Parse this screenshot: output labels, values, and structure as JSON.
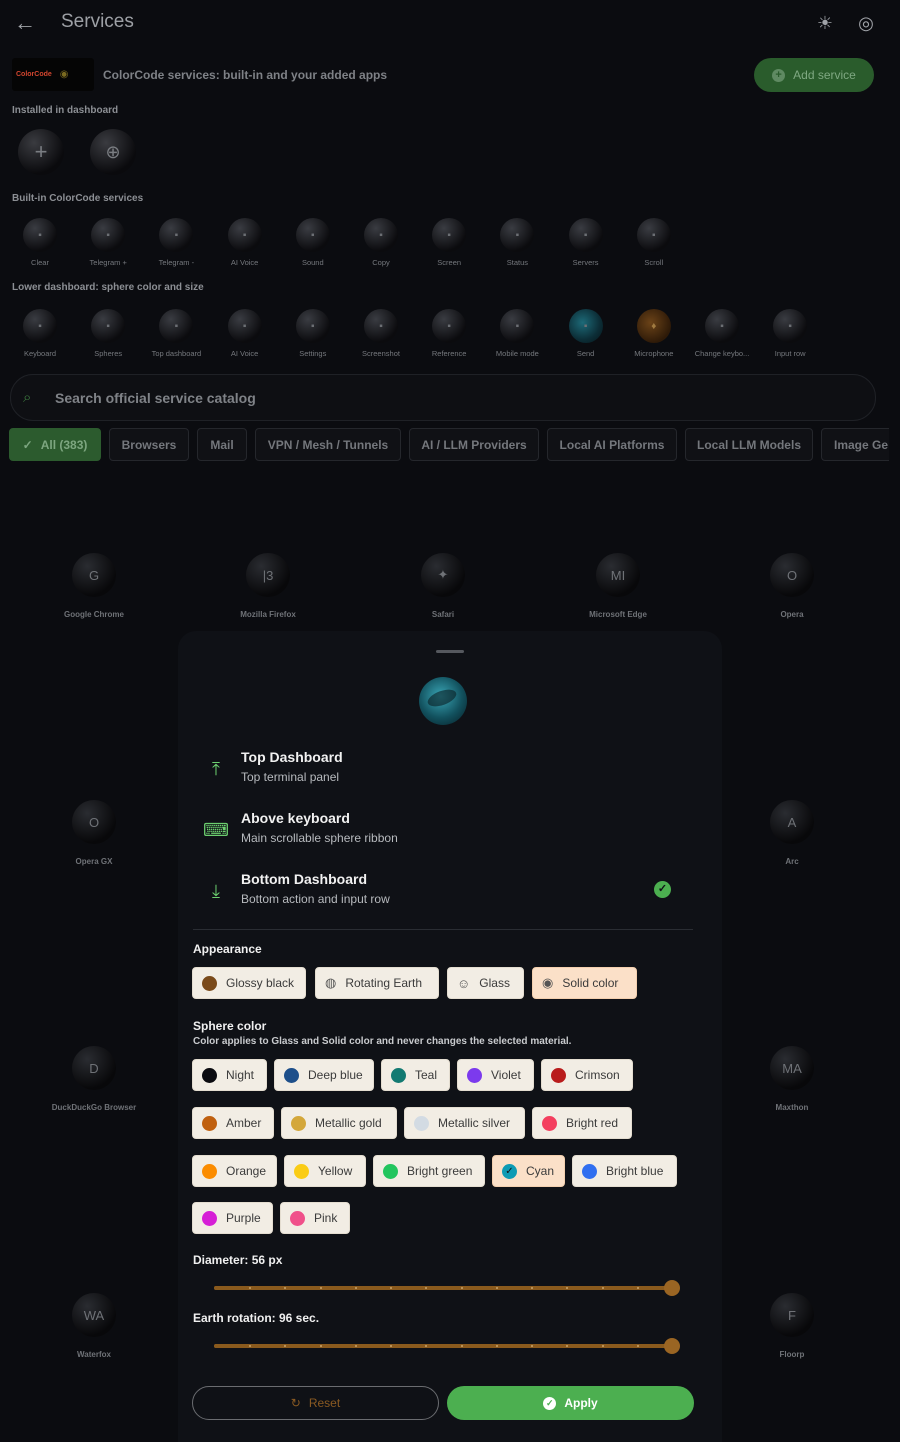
{
  "topbar": {
    "title": "Services",
    "back_icon": "arrow-left-icon",
    "theme_icon": "sun-icon",
    "lang_icon": "globe-icon"
  },
  "header": {
    "logo_text": "ColorCode",
    "subtitle": "ColorCode services: built-in and your added apps",
    "add_label": "Add service"
  },
  "installed": {
    "label": "Installed in dashboard",
    "items": [
      "plus-icon",
      "globe-icon"
    ]
  },
  "builtin": {
    "label": "Built-in ColorCode services",
    "items": [
      "Clear",
      "Telegram +",
      "Telegram -",
      "AI Voice",
      "Sound",
      "Copy",
      "Screen",
      "Status",
      "Servers",
      "Scroll"
    ]
  },
  "lower": {
    "label": "Lower dashboard: sphere color and size",
    "items": [
      "Keyboard",
      "Spheres",
      "Top dashboard",
      "AI Voice",
      "Settings",
      "Screenshot",
      "Reference",
      "Mobile mode",
      "Send",
      "Microphone",
      "Change keybo...",
      "Input row"
    ]
  },
  "search": {
    "placeholder": "Search official service catalog"
  },
  "chips": [
    "All (383)",
    "Browsers",
    "Mail",
    "VPN / Mesh / Tunnels",
    "AI / LLM Providers",
    "Local AI Platforms",
    "Local LLM Models",
    "Image Ge"
  ],
  "catalog": [
    {
      "name": "Google Chrome",
      "glyph": "G"
    },
    {
      "name": "Mozilla Firefox",
      "glyph": "|3"
    },
    {
      "name": "Safari",
      "glyph": "✦"
    },
    {
      "name": "Microsoft Edge",
      "glyph": "MI"
    },
    {
      "name": "Opera",
      "glyph": "O"
    },
    {
      "name": "Opera GX",
      "glyph": "O"
    },
    {
      "name": "Arc",
      "glyph": "A"
    },
    {
      "name": "DuckDuckGo Browser",
      "glyph": "D"
    },
    {
      "name": "Maxthon",
      "glyph": "MA"
    },
    {
      "name": "Waterfox",
      "glyph": "WA"
    },
    {
      "name": "Floorp",
      "glyph": "F"
    }
  ],
  "sheet": {
    "options": [
      {
        "title": "Top Dashboard",
        "sub": "Top terminal panel",
        "icon": "arrow-up-bar-icon"
      },
      {
        "title": "Above keyboard",
        "sub": "Main scrollable sphere ribbon",
        "icon": "keyboard-icon"
      },
      {
        "title": "Bottom Dashboard",
        "sub": "Bottom action and input row",
        "icon": "arrow-down-bar-icon",
        "selected": true
      }
    ],
    "appearance_label": "Appearance",
    "appearance": [
      {
        "label": "Glossy black",
        "color": "#7a4a1a"
      },
      {
        "label": "Rotating Earth",
        "icon": "earth-icon"
      },
      {
        "label": "Glass",
        "icon": "smile-icon"
      },
      {
        "label": "Solid color",
        "icon": "palette-icon",
        "selected": true
      }
    ],
    "color_label": "Sphere color",
    "color_note": "Color applies to Glass and Solid color and never changes the selected material.",
    "colors": [
      {
        "label": "Night",
        "color": "#0b0b10"
      },
      {
        "label": "Deep blue",
        "color": "#1e4f8a"
      },
      {
        "label": "Teal",
        "color": "#137a72"
      },
      {
        "label": "Violet",
        "color": "#7c3aed"
      },
      {
        "label": "Crimson",
        "color": "#b91c1c"
      },
      {
        "label": "Amber",
        "color": "#c0600f"
      },
      {
        "label": "Metallic gold",
        "color": "#d4a73a"
      },
      {
        "label": "Metallic silver",
        "color": "#d3dbe3"
      },
      {
        "label": "Bright red",
        "color": "#f43f5e"
      },
      {
        "label": "Orange",
        "color": "#fb8c00"
      },
      {
        "label": "Yellow",
        "color": "#facc15"
      },
      {
        "label": "Bright green",
        "color": "#22c55e"
      },
      {
        "label": "Cyan",
        "color": "#0e9bb4",
        "selected": true
      },
      {
        "label": "Bright blue",
        "color": "#2f6ff0"
      },
      {
        "label": "Purple",
        "color": "#d61fd6"
      },
      {
        "label": "Pink",
        "color": "#f0508a"
      }
    ],
    "diameter_label": "Diameter: 56 px",
    "diameter_value": 1.0,
    "rotation_label": "Earth rotation: 96 sec.",
    "rotation_value": 1.0,
    "reset_label": "Reset",
    "apply_label": "Apply"
  }
}
